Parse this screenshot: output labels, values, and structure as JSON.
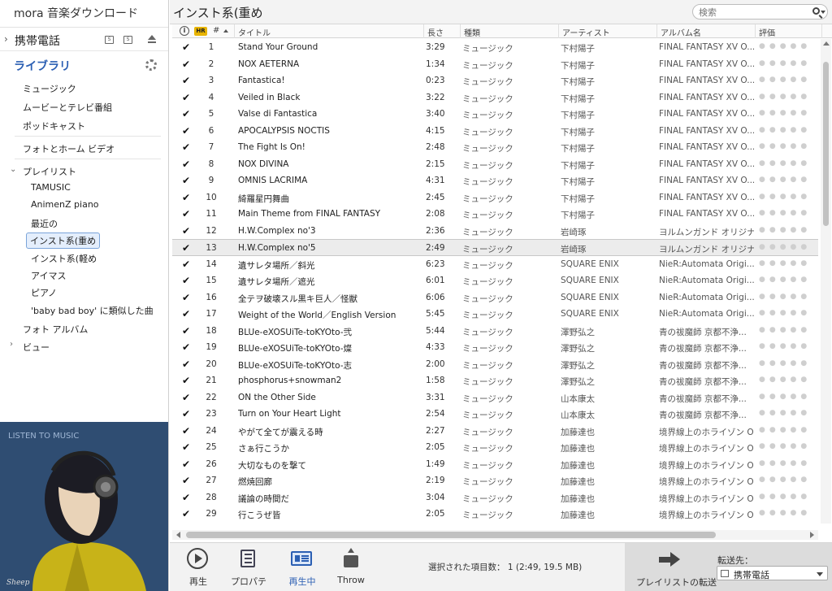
{
  "app": {
    "title": "mora 音楽ダウンロード"
  },
  "sidebar": {
    "device": {
      "label": "携帯電話",
      "icon1": "S",
      "icon2": "S"
    },
    "library": {
      "label": "ライブラリ"
    },
    "items": [
      {
        "label": "ミュージック"
      },
      {
        "label": "ムービーとテレビ番組"
      },
      {
        "label": "ポッドキャスト"
      },
      {
        "label": "フォトとホーム ビデオ"
      },
      {
        "label": "プレイリスト"
      },
      {
        "label": "TAMUSIC"
      },
      {
        "label": "AnimenZ piano"
      },
      {
        "label": "最近の"
      },
      {
        "label": "インスト系(重め"
      },
      {
        "label": "インスト系(軽め"
      },
      {
        "label": "アイマス"
      },
      {
        "label": "ピアノ"
      },
      {
        "label": "'baby bad boy' に類似した曲"
      },
      {
        "label": "フォト アルバム"
      },
      {
        "label": "ビュー"
      }
    ],
    "artwork": {
      "text": "LISTEN TO MUSIC",
      "signature": "Sheep"
    }
  },
  "main": {
    "title": "インスト系(重め",
    "search_placeholder": "検索",
    "columns": {
      "info": "i",
      "hr": "HR",
      "num": "#",
      "title": "タイトル",
      "length": "長さ",
      "genre": "種類",
      "artist": "アーティスト",
      "album": "アルバム名",
      "rating": "評価"
    },
    "rows": [
      {
        "chk": "✔",
        "num": "1",
        "title": "Stand Your Ground",
        "length": "3:29",
        "genre": "ミュージック",
        "artist": "下村陽子",
        "album": "FINAL FANTASY XV O..."
      },
      {
        "chk": "✔",
        "num": "2",
        "title": "NOX AETERNA",
        "length": "1:34",
        "genre": "ミュージック",
        "artist": "下村陽子",
        "album": "FINAL FANTASY XV O..."
      },
      {
        "chk": "✔",
        "num": "3",
        "title": "Fantastica!",
        "length": "0:23",
        "genre": "ミュージック",
        "artist": "下村陽子",
        "album": "FINAL FANTASY XV O..."
      },
      {
        "chk": "✔",
        "num": "4",
        "title": "Veiled in Black",
        "length": "3:22",
        "genre": "ミュージック",
        "artist": "下村陽子",
        "album": "FINAL FANTASY XV O..."
      },
      {
        "chk": "✔",
        "num": "5",
        "title": "Valse di Fantastica",
        "length": "3:40",
        "genre": "ミュージック",
        "artist": "下村陽子",
        "album": "FINAL FANTASY XV O..."
      },
      {
        "chk": "✔",
        "num": "6",
        "title": "APOCALYPSIS NOCTIS",
        "length": "4:15",
        "genre": "ミュージック",
        "artist": "下村陽子",
        "album": "FINAL FANTASY XV O..."
      },
      {
        "chk": "✔",
        "num": "7",
        "title": "The Fight Is On!",
        "length": "2:48",
        "genre": "ミュージック",
        "artist": "下村陽子",
        "album": "FINAL FANTASY XV O..."
      },
      {
        "chk": "✔",
        "num": "8",
        "title": "NOX DIVINA",
        "length": "2:15",
        "genre": "ミュージック",
        "artist": "下村陽子",
        "album": "FINAL FANTASY XV O..."
      },
      {
        "chk": "✔",
        "num": "9",
        "title": "OMNIS LACRIMA",
        "length": "4:31",
        "genre": "ミュージック",
        "artist": "下村陽子",
        "album": "FINAL FANTASY XV O..."
      },
      {
        "chk": "✔",
        "num": "10",
        "title": "綺羅星円舞曲",
        "length": "2:45",
        "genre": "ミュージック",
        "artist": "下村陽子",
        "album": "FINAL FANTASY XV O..."
      },
      {
        "chk": "✔",
        "num": "11",
        "title": "Main Theme from FINAL FANTASY",
        "length": "2:08",
        "genre": "ミュージック",
        "artist": "下村陽子",
        "album": "FINAL FANTASY XV O..."
      },
      {
        "chk": "✔",
        "num": "12",
        "title": "H.W.Complex no'3",
        "length": "2:36",
        "genre": "ミュージック",
        "artist": "岩崎琢",
        "album": "ヨルムンガンド オリジナル..."
      },
      {
        "chk": "✔",
        "num": "13",
        "title": "H.W.Complex no'5",
        "length": "2:49",
        "genre": "ミュージック",
        "artist": "岩崎琢",
        "album": "ヨルムンガンド オリジナル...",
        "selected": true
      },
      {
        "chk": "✔",
        "num": "14",
        "title": "遺サレタ場所／斜光",
        "length": "6:23",
        "genre": "ミュージック",
        "artist": "SQUARE ENIX",
        "album": "NieR:Automata Origi..."
      },
      {
        "chk": "✔",
        "num": "15",
        "title": "遺サレタ場所／遮光",
        "length": "6:01",
        "genre": "ミュージック",
        "artist": "SQUARE ENIX",
        "album": "NieR:Automata Origi..."
      },
      {
        "chk": "✔",
        "num": "16",
        "title": "全テヲ破壊スル黒キ巨人／怪獣",
        "length": "6:06",
        "genre": "ミュージック",
        "artist": "SQUARE ENIX",
        "album": "NieR:Automata Origi..."
      },
      {
        "chk": "✔",
        "num": "17",
        "title": "Weight of the World／English Version",
        "length": "5:45",
        "genre": "ミュージック",
        "artist": "SQUARE ENIX",
        "album": "NieR:Automata Origi..."
      },
      {
        "chk": "✔",
        "num": "18",
        "title": "BLUe-eXOSUiTe-toKYOto-弐",
        "length": "5:44",
        "genre": "ミュージック",
        "artist": "澤野弘之",
        "album": "青の祓魔師 京都不浄..."
      },
      {
        "chk": "✔",
        "num": "19",
        "title": "BLUe-eXOSUiTe-toKYOto-燦",
        "length": "4:33",
        "genre": "ミュージック",
        "artist": "澤野弘之",
        "album": "青の祓魔師 京都不浄..."
      },
      {
        "chk": "✔",
        "num": "20",
        "title": "BLUe-eXOSUiTe-toKYOto-志",
        "length": "2:00",
        "genre": "ミュージック",
        "artist": "澤野弘之",
        "album": "青の祓魔師 京都不浄..."
      },
      {
        "chk": "✔",
        "num": "21",
        "title": "phosphorus+snowman2",
        "length": "1:58",
        "genre": "ミュージック",
        "artist": "澤野弘之",
        "album": "青の祓魔師 京都不浄..."
      },
      {
        "chk": "✔",
        "num": "22",
        "title": "ON the Other Side",
        "length": "3:31",
        "genre": "ミュージック",
        "artist": "山本康太",
        "album": "青の祓魔師 京都不浄..."
      },
      {
        "chk": "✔",
        "num": "23",
        "title": "Turn on Your Heart Light",
        "length": "2:54",
        "genre": "ミュージック",
        "artist": "山本康太",
        "album": "青の祓魔師 京都不浄..."
      },
      {
        "chk": "✔",
        "num": "24",
        "title": "やがて全てが震える時",
        "length": "2:27",
        "genre": "ミュージック",
        "artist": "加藤達也",
        "album": "境界線上のホライゾン O..."
      },
      {
        "chk": "✔",
        "num": "25",
        "title": "さぁ行こうか",
        "length": "2:05",
        "genre": "ミュージック",
        "artist": "加藤達也",
        "album": "境界線上のホライゾン O..."
      },
      {
        "chk": "✔",
        "num": "26",
        "title": "大切なものを撃て",
        "length": "1:49",
        "genre": "ミュージック",
        "artist": "加藤達也",
        "album": "境界線上のホライゾン O..."
      },
      {
        "chk": "✔",
        "num": "27",
        "title": "燃焼回廊",
        "length": "2:19",
        "genre": "ミュージック",
        "artist": "加藤達也",
        "album": "境界線上のホライゾン O..."
      },
      {
        "chk": "✔",
        "num": "28",
        "title": "議論の時間だ",
        "length": "3:04",
        "genre": "ミュージック",
        "artist": "加藤達也",
        "album": "境界線上のホライゾン O..."
      },
      {
        "chk": "✔",
        "num": "29",
        "title": "行こうぜ皆",
        "length": "2:05",
        "genre": "ミュージック",
        "artist": "加藤達也",
        "album": "境界線上のホライゾン O..."
      }
    ],
    "rating_dots": "●●●●●"
  },
  "toolbar": {
    "play": "再生",
    "properties": "プロパティ",
    "now_playing": "再生中",
    "throw": "Throw",
    "selection_info": "選択された項目数： 1 (2:49, 19.5 MB)",
    "transfer_label": "プレイリストの転送",
    "dest_label": "転送先：",
    "dest_value": "携帯電話"
  },
  "colors": {
    "accent": "#2b5fb3",
    "selection": "#ececec",
    "hr_badge": "#e8b400"
  }
}
